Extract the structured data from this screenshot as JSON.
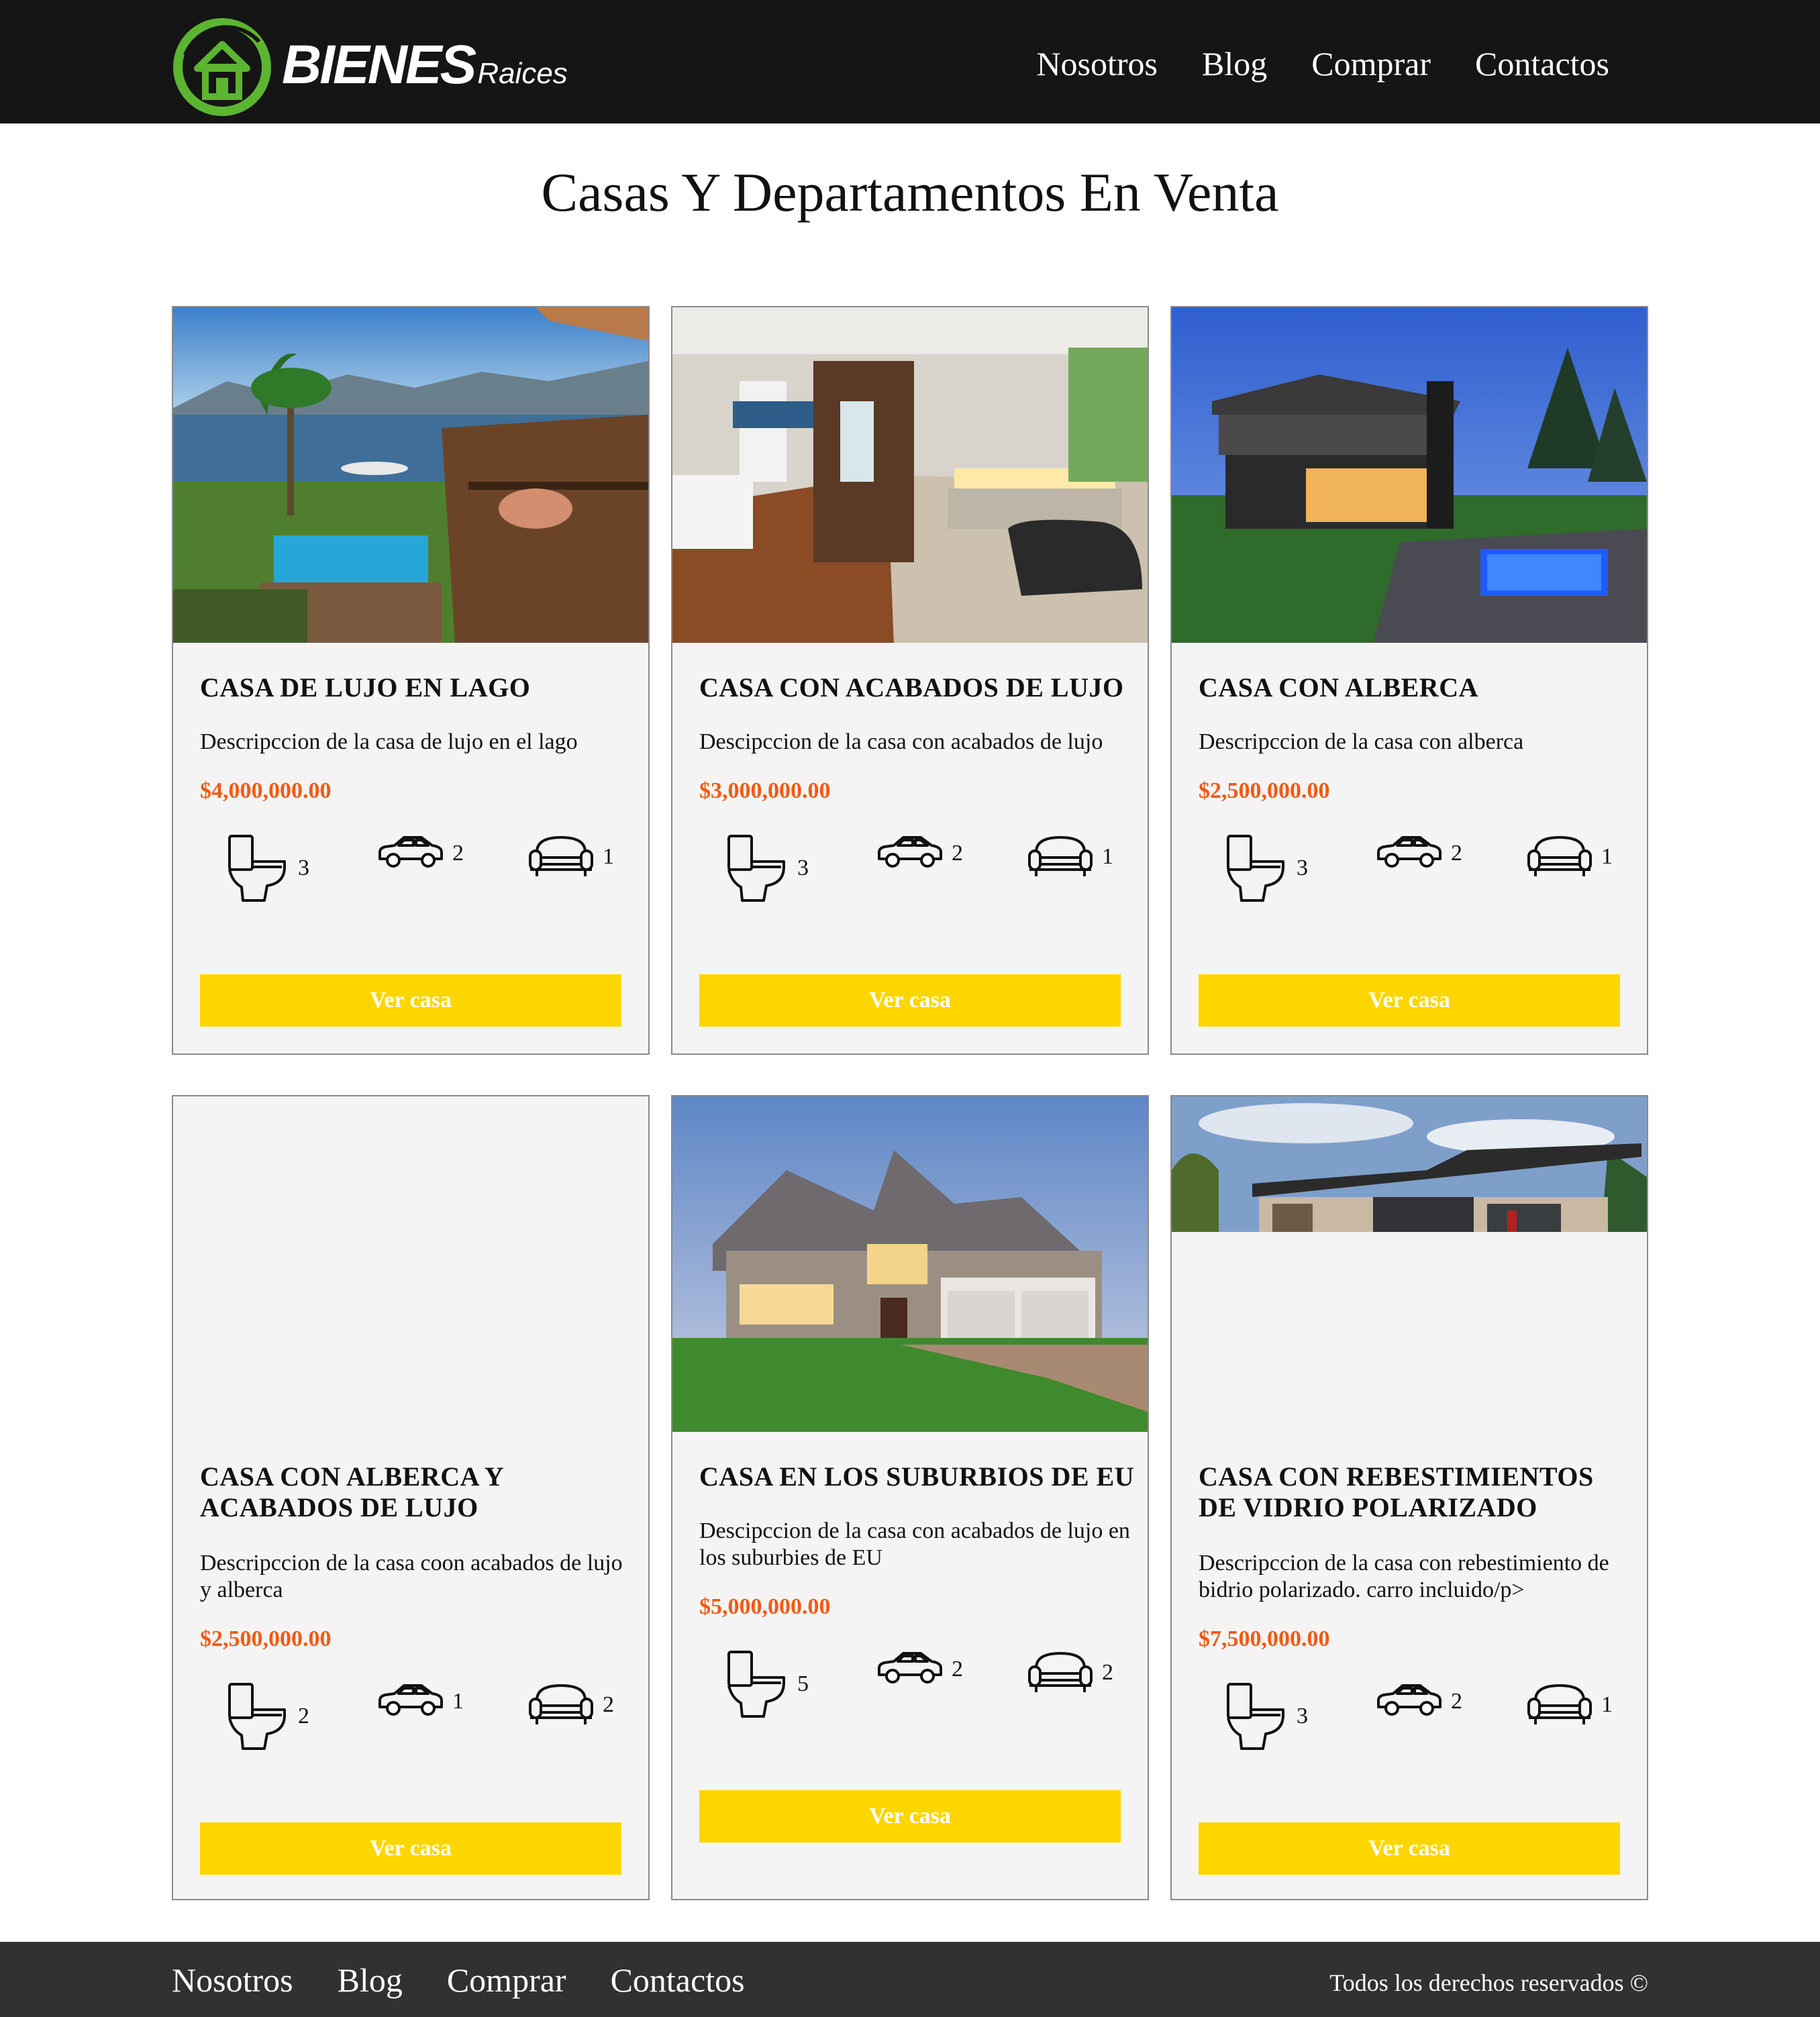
{
  "brand": {
    "logo_main": "BIENES",
    "logo_sub": "Raices"
  },
  "nav": {
    "items": [
      "Nosotros",
      "Blog",
      "Comprar",
      "Contactos"
    ]
  },
  "main": {
    "title": "Casas Y Departamentos En Venta"
  },
  "listings": [
    {
      "title": "CASA DE LUJO EN LAGO",
      "description": "Descripccion de la casa de lujo en el lago",
      "price": "$4,000,000.00",
      "wc": "3",
      "parking": "2",
      "rooms": "1",
      "button": "Ver casa"
    },
    {
      "title": "CASA CON ACABADOS DE LUJO",
      "description": "Descipccion de la casa con acabados de lujo",
      "price": "$3,000,000.00",
      "wc": "3",
      "parking": "2",
      "rooms": "1",
      "button": "Ver casa"
    },
    {
      "title": "CASA CON ALBERCA",
      "description": "Descripccion de la casa con alberca",
      "price": "$2,500,000.00",
      "wc": "3",
      "parking": "2",
      "rooms": "1",
      "button": "Ver casa"
    },
    {
      "title": "CASA CON ALBERCA Y ACABADOS DE LUJO",
      "description": "Descripccion de la casa coon acabados de lujo y alberca",
      "price": "$2,500,000.00",
      "wc": "2",
      "parking": "1",
      "rooms": "2",
      "button": "Ver casa"
    },
    {
      "title": "CASA EN LOS SUBURBIOS DE EU",
      "description": "Descipccion de la casa con acabados de lujo en los suburbies de EU",
      "price": "$5,000,000.00",
      "wc": "5",
      "parking": "2",
      "rooms": "2",
      "button": "Ver casa"
    },
    {
      "title": "CASA CON REBESTIMIENTOS DE VIDRIO POLARIZADO",
      "description": "Descripccion de la casa con rebestimiento de bidrio polarizado. carro incluido/p>",
      "price": "$7,500,000.00",
      "wc": "3",
      "parking": "2",
      "rooms": "1",
      "button": "Ver casa"
    }
  ],
  "footer": {
    "nav": [
      "Nosotros",
      "Blog",
      "Comprar",
      "Contactos"
    ],
    "copyright": "Todos los derechos reservados ©"
  },
  "colors": {
    "header_bg": "#151515",
    "footer_bg": "#313131",
    "price": "#f15a14",
    "button": "#fdd600",
    "logo_green": "#5cb531"
  },
  "icons": [
    "toilet-icon",
    "car-icon",
    "sofa-icon"
  ]
}
